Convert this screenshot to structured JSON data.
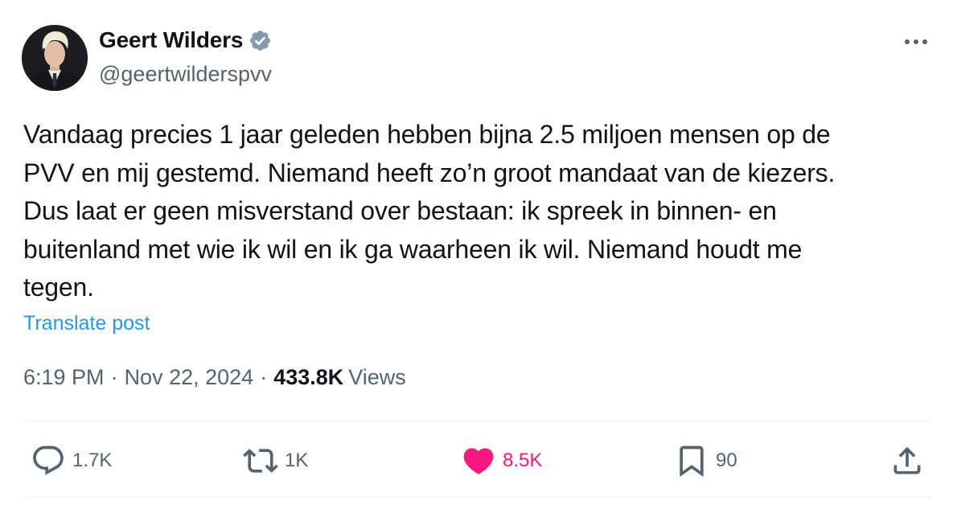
{
  "author": {
    "display_name": "Geert Wilders",
    "handle": "@geertwilderspvv",
    "verified": true,
    "avatar_icon": "profile-photo"
  },
  "tweet": {
    "text": "Vandaag precies 1 jaar geleden hebben bijna 2.5 miljoen mensen op de\nPVV en mij gestemd. Niemand heeft zo’n groot mandaat van de kiezers.\nDus laat er geen misverstand over bestaan: ik spreek in binnen- en\nbuitenland met wie ik wil en ik ga waarheen ik wil. Niemand houdt me\ntegen.",
    "translate_label": "Translate post"
  },
  "meta": {
    "time": "6:19 PM",
    "separator": "·",
    "date": "Nov 22, 2024",
    "views_count": "433.8K",
    "views_label": "Views"
  },
  "actions": {
    "replies": "1.7K",
    "reposts": "1K",
    "likes": "8.5K",
    "bookmarks": "90",
    "liked": true
  },
  "colors": {
    "text_primary": "#0f1419",
    "text_secondary": "#536471",
    "link": "#1d9bf0",
    "like_active": "#f91880",
    "verified_badge": "#829aab",
    "divider": "#eff3f4"
  }
}
